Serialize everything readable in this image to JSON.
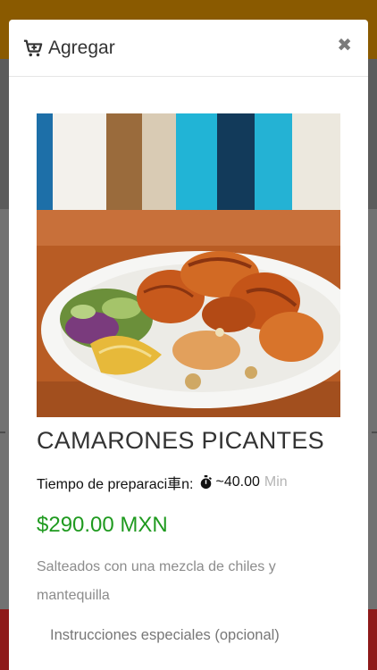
{
  "modal": {
    "title": "Agregar",
    "close_icon": "close-icon",
    "cart_icon": "cart-plus-icon"
  },
  "product": {
    "name": "CAMARONES PICANTES",
    "prep_label": "Tiempo de preparaci車n:",
    "prep_value": "~40.00",
    "prep_unit": "Min",
    "price": "$290.00 MXN",
    "description": "Salteados con una mezcla de chiles y mantequilla",
    "photo": "plated spicy shrimp with salad and lemon"
  },
  "form": {
    "instructions_label": "Instrucciones especiales (opcional)"
  },
  "colors": {
    "price": "#1f9a1f",
    "top_bar": "#8a5a00",
    "bottom_bar": "#8e1a1a"
  }
}
